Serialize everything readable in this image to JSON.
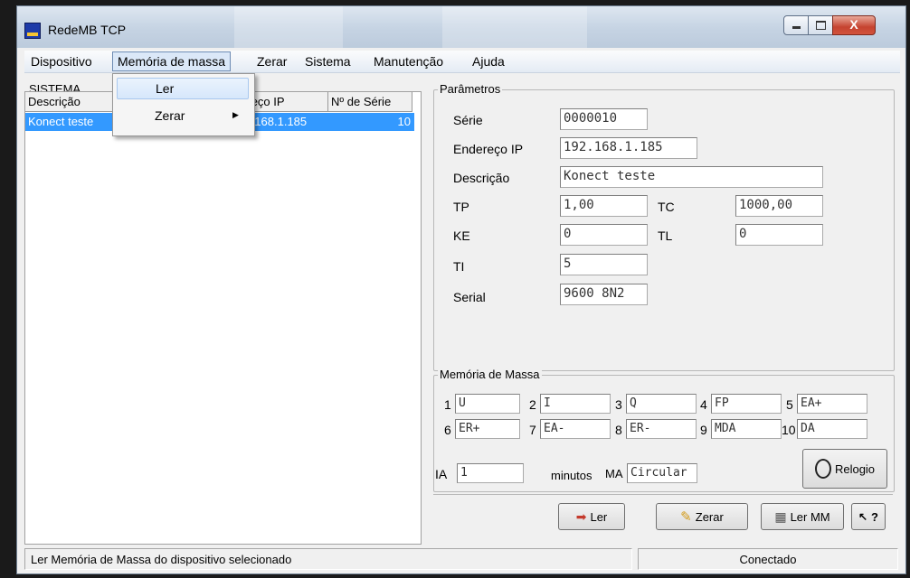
{
  "window": {
    "title": "RedeMB TCP",
    "close_glyph": "X"
  },
  "menu": [
    "Dispositivo",
    "Memória de massa",
    "Zerar",
    "Sistema",
    "Manutenção",
    "Ajuda"
  ],
  "dropdown": {
    "items": [
      "Ler",
      "Zerar"
    ],
    "submenu_arrow": "▶"
  },
  "sistema": {
    "legend": "SISTEMA",
    "columns": [
      "Descrição",
      "Endereço IP",
      "Nº de Série"
    ],
    "rows": [
      {
        "descricao": "Konect teste",
        "ip": "192.168.1.185",
        "serie": "10"
      }
    ]
  },
  "parametros": {
    "legend": "Parâmetros",
    "serie_label": "Série",
    "serie_value": "0000010",
    "ip_label": "Endereço IP",
    "ip_value": "192.168.1.185",
    "descricao_label": "Descrição",
    "descricao_value": "Konect teste",
    "tp_label": "TP",
    "tp_value": "1,00",
    "tc_label": "TC",
    "tc_value": "1000,00",
    "ke_label": "KE",
    "ke_value": "0",
    "tl_label": "TL",
    "tl_value": "0",
    "ti_label": "TI",
    "ti_value": "5",
    "serial_label": "Serial",
    "serial_value": "9600 8N2"
  },
  "memoria": {
    "legend": "Memória de Massa",
    "slots": [
      {
        "n": "1",
        "v": "U"
      },
      {
        "n": "2",
        "v": "I"
      },
      {
        "n": "3",
        "v": "Q"
      },
      {
        "n": "4",
        "v": "FP"
      },
      {
        "n": "5",
        "v": "EA+"
      },
      {
        "n": "6",
        "v": "ER+"
      },
      {
        "n": "7",
        "v": "EA-"
      },
      {
        "n": "8",
        "v": "ER-"
      },
      {
        "n": "9",
        "v": "MDA"
      },
      {
        "n": "10",
        "v": "DA"
      }
    ],
    "ia_label": "IA",
    "ia_value": "1",
    "minutos_label": "minutos",
    "ma_label": "MA",
    "ma_value": "Circular",
    "relogio_label": "Relogio"
  },
  "buttons": {
    "ler": "Ler",
    "zerar": "Zerar",
    "ler_mm": "Ler MM",
    "help": "?"
  },
  "status": {
    "message": "Ler Memória de Massa do dispositivo selecionado",
    "connection": "Conectado"
  },
  "colors": {
    "selection": "#3399ff",
    "close_button": "#c54330",
    "menu_highlight": "#dbe8f8"
  }
}
